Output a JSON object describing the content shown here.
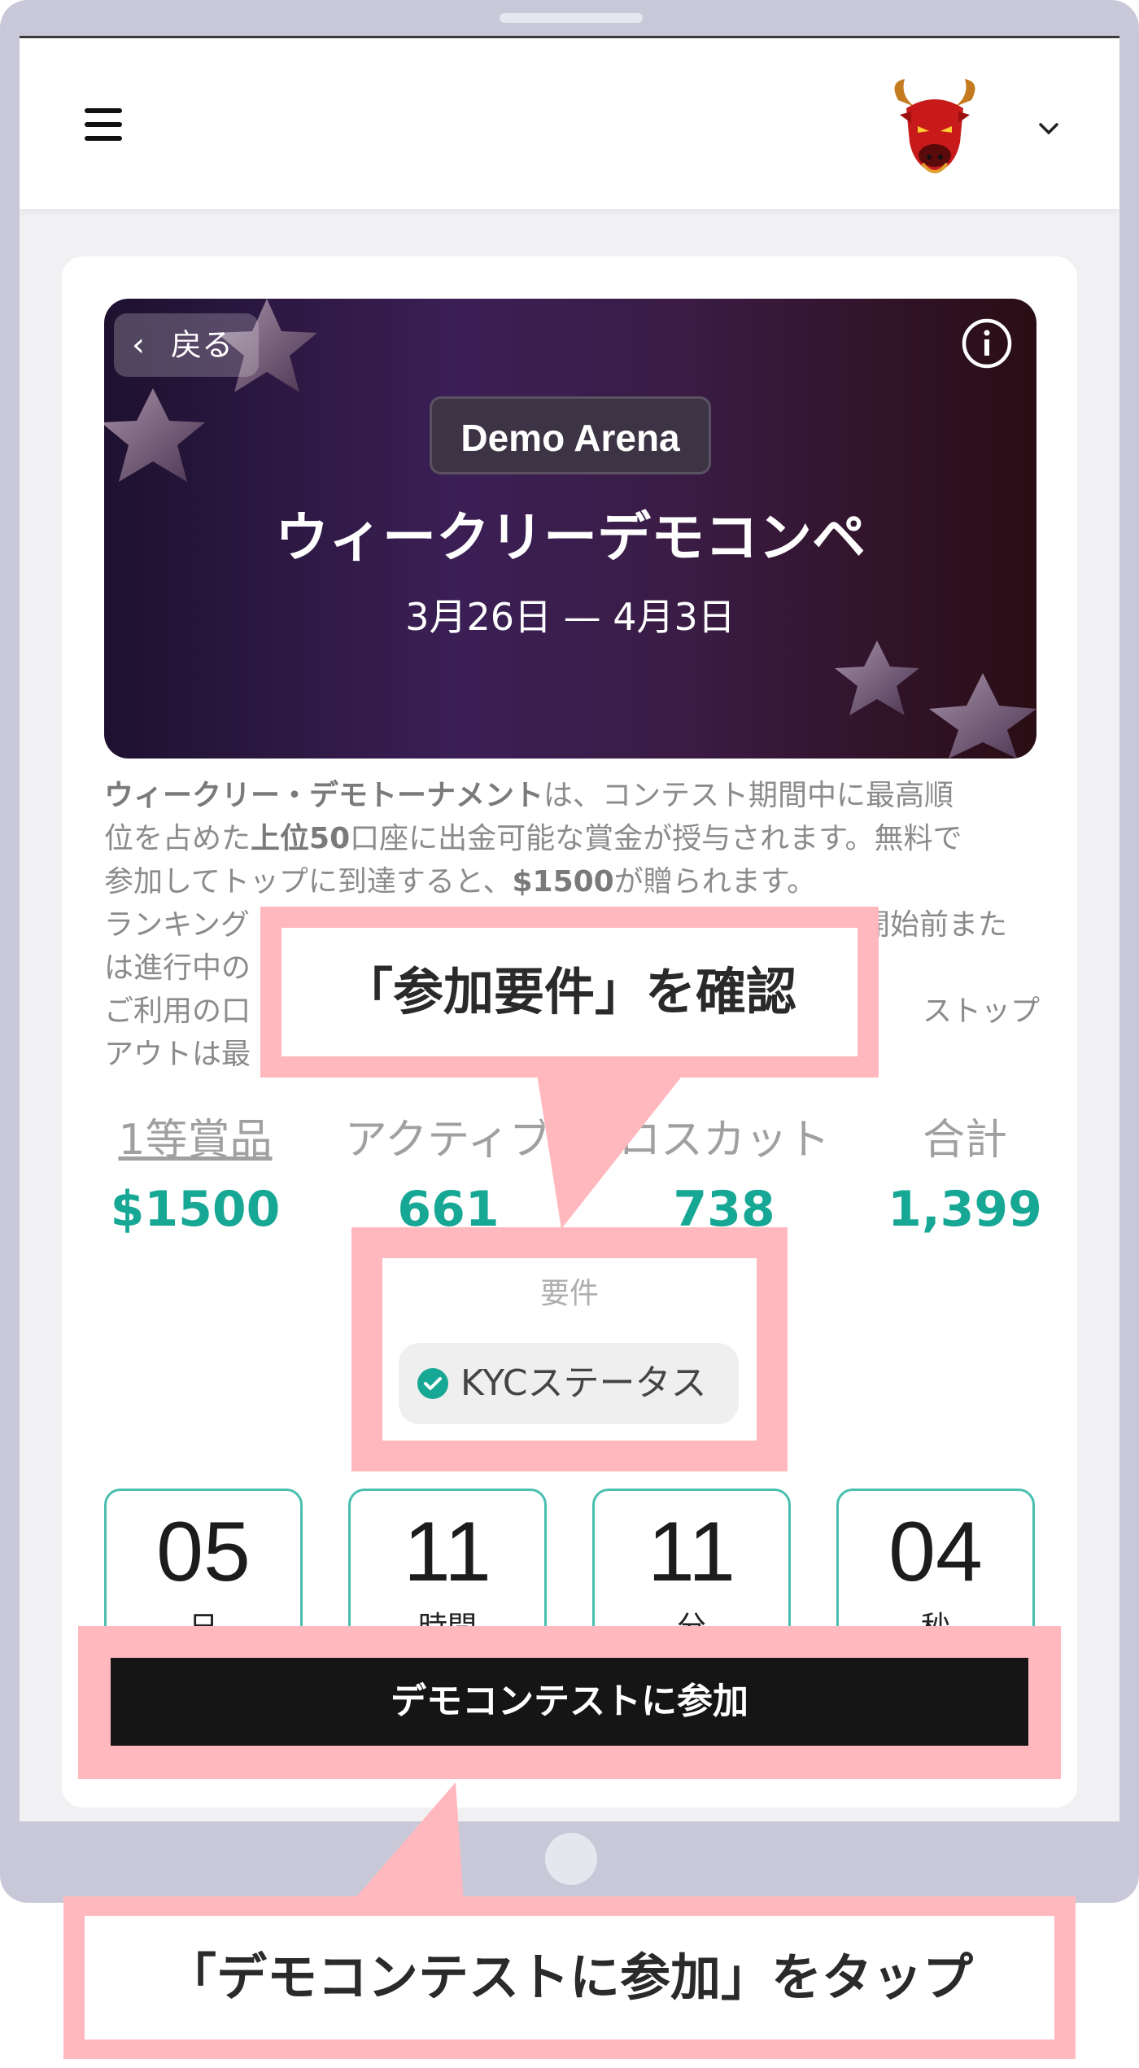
{
  "app": {
    "back_label": "戻る",
    "badge": "Demo Arena",
    "title": "ウィークリーデモコンペ",
    "dates": "3月26日 — 4月3日"
  },
  "description": {
    "l1_bold": "ウィークリー・デモトーナメント",
    "l1_rest": "は、コンテスト期間中に最高順",
    "l2_a": "位を占めた",
    "l2_bold1": "上位50",
    "l2_b": "口座に出金可能な賞金が授与されます。無料で",
    "l3_a": "参加してトップに到達すると、",
    "l3_bold": "$1500",
    "l3_b": "が贈られます。",
    "l4_a": "ランキング",
    "l4_b": "開始前また",
    "l5_a": "は進行中の",
    "l6_a": "ご利用の口",
    "l6_b": "ストップ",
    "l7_a": "アウトは最"
  },
  "stats": [
    {
      "label": "1等賞品",
      "value": "$1500"
    },
    {
      "label": "アクティブ",
      "value": "661"
    },
    {
      "label": "ロスカット",
      "value": "738"
    },
    {
      "label": "合計",
      "value": "1,399"
    }
  ],
  "requirements": {
    "heading": "要件",
    "kyc_label": "KYCステータス"
  },
  "countdown": [
    {
      "value": "05",
      "unit": "日"
    },
    {
      "value": "11",
      "unit": "時間"
    },
    {
      "value": "11",
      "unit": "分"
    },
    {
      "value": "04",
      "unit": "秒"
    }
  ],
  "join_button": "デモコンテストに参加",
  "callouts": {
    "check_requirements": "「参加要件」を確認",
    "tap_join": "「デモコンテストに参加」をタップ"
  },
  "colors": {
    "accent_teal": "#17a795",
    "highlight_pink": "#ffb8bd",
    "button_dark": "#151515"
  },
  "icons": [
    "hamburger-icon",
    "bull-avatar-icon",
    "chevron-down-icon",
    "chevron-left-icon",
    "info-icon",
    "check-circle-icon"
  ]
}
